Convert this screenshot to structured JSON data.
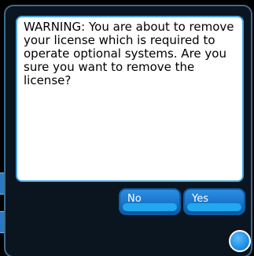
{
  "dialog": {
    "message": "WARNING: You are about to remove your license which is required to operate optional systems.  Are you sure you want to remove the license?",
    "buttons": {
      "no_label": "No",
      "yes_label": "Yes"
    }
  },
  "colors": {
    "background": "#000000",
    "panel_border": "#44a6e0",
    "button_blue": "#1a77cc",
    "home_button": "#1f8fe6"
  },
  "icons": {
    "home_button": "circle-button-icon"
  }
}
